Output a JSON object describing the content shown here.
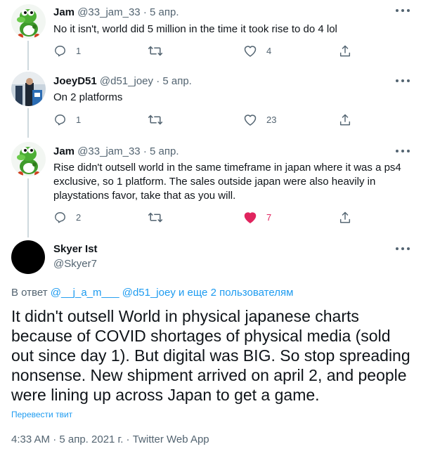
{
  "replies": [
    {
      "name": "Jam",
      "handle": "@33_jam_33",
      "separator": "·",
      "date": "5 апр.",
      "text": "No it isn't, world did 5 million in the time it took rise to do 4 lol",
      "counts": {
        "reply": "1",
        "retweet": "",
        "like": "4"
      },
      "liked": false
    },
    {
      "name": "JoeyD51",
      "handle": "@d51_joey",
      "separator": "·",
      "date": "5 апр.",
      "text": "On 2 platforms",
      "counts": {
        "reply": "1",
        "retweet": "",
        "like": "23"
      },
      "liked": false
    },
    {
      "name": "Jam",
      "handle": "@33_jam_33",
      "separator": "·",
      "date": "5 апр.",
      "text": "Rise didn't outsell world in the same timeframe in japan where it was a ps4 exclusive, so 1 platform. The sales outside japan were also heavily in playstations favor, take that as you will.",
      "counts": {
        "reply": "2",
        "retweet": "",
        "like": "7"
      },
      "liked": true
    }
  ],
  "main_tweet": {
    "name": "Skyer Ist",
    "handle": "@Skyer7",
    "reply_prefix": "В ответ",
    "reply_users": "@__j_a_m___ @d51_joey",
    "reply_suffix": "и еще 2 пользователям",
    "text": "It didn't outsell World in physical japanese charts because of COVID shortages of physical media (sold out since day 1). But digital was BIG. So stop spreading nonsense. New shipment arrived on april 2, and people were lining up across Japan to get a game.",
    "translate_label": "Перевести твит",
    "meta": "4:33 AM · 5 апр. 2021 г. · Twitter Web App"
  },
  "icons": {
    "reply": "reply-icon",
    "retweet": "retweet-icon",
    "like": "heart-icon",
    "share": "share-icon",
    "more": "more-options-icon"
  },
  "colors": {
    "text": "#0f1419",
    "secondary": "#536471",
    "link": "#1d9bf0",
    "like": "#e0245e",
    "thread_line": "#cfd9de"
  }
}
